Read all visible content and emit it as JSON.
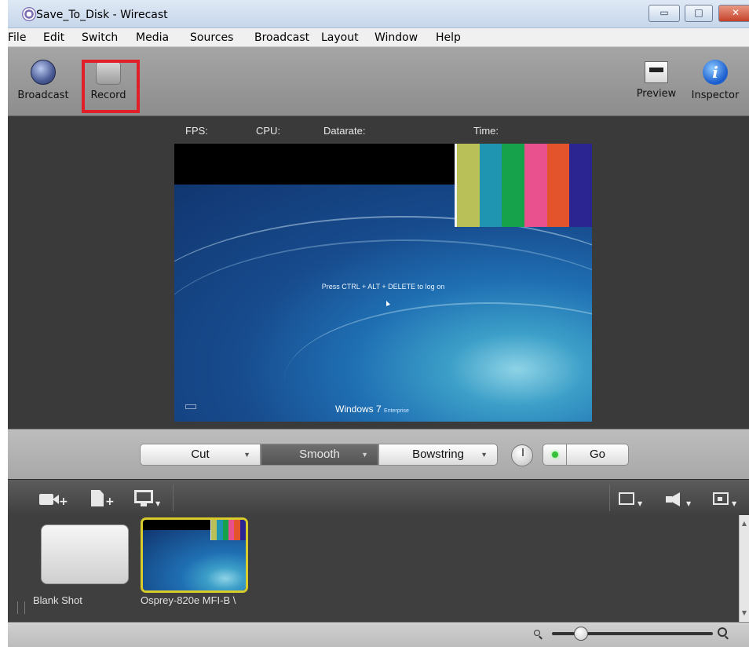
{
  "window": {
    "title": "Save_To_Disk - Wirecast",
    "minimize": "▭",
    "maximize": "□",
    "close": "✕"
  },
  "menu": [
    "File",
    "Edit",
    "Switch",
    "Media",
    "Sources",
    "Broadcast",
    "Layout",
    "Window",
    "Help"
  ],
  "toolbar": {
    "broadcast_label": "Broadcast",
    "record_label": "Record",
    "preview_label": "Preview",
    "inspector_label": "Inspector",
    "inspector_glyph": "i"
  },
  "stats": {
    "fps": "FPS:",
    "cpu": "CPU:",
    "datarate": "Datarate:",
    "time": "Time:"
  },
  "preview": {
    "logon_text": "Press CTRL + ALT + DELETE to log on",
    "os_name": "Windows 7",
    "os_edition": "Enterprise",
    "color_bars": [
      "#b9c057",
      "#1f95b2",
      "#16a24b",
      "#e8508e",
      "#e3542d",
      "#2a2590"
    ]
  },
  "transitions": {
    "cut": "Cut",
    "smooth": "Smooth",
    "bowstring": "Bowstring",
    "go": "Go",
    "caret": "▼"
  },
  "shots": [
    {
      "label": "Blank Shot"
    },
    {
      "label": "Osprey-820e MFI-B \\"
    }
  ],
  "highlight_color": "#e01f28",
  "selected_shot_color": "#d8cb2a"
}
